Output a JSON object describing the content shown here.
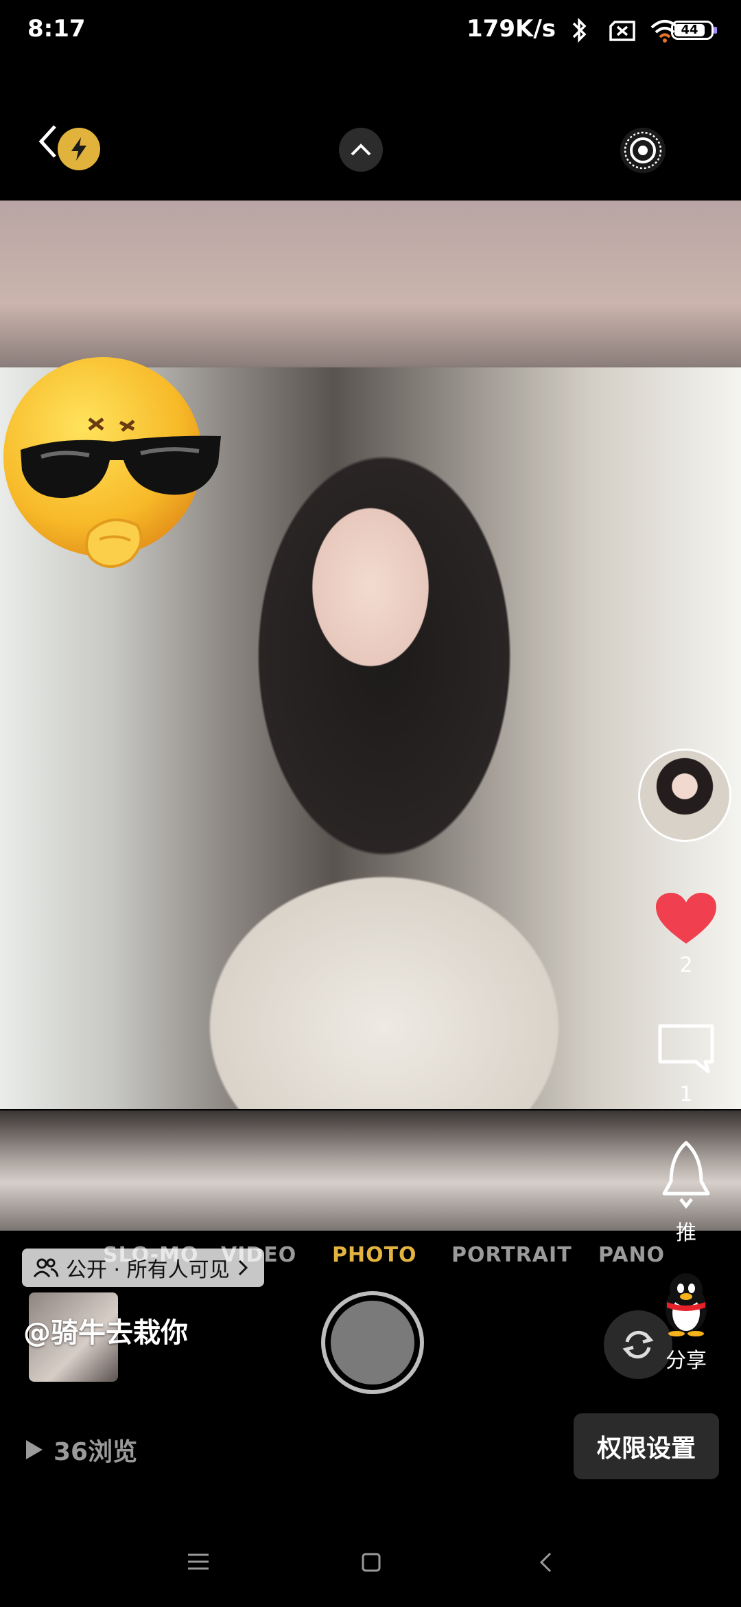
{
  "status_bar": {
    "time": "8:17",
    "net_speed": "179K/s",
    "battery_level": "44",
    "icons": [
      "bluetooth-icon",
      "sim-off-icon",
      "wifi-icon",
      "battery-icon"
    ]
  },
  "camera": {
    "modes": [
      "SLO-MO",
      "VIDEO",
      "PHOTO",
      "PORTRAIT",
      "PANO"
    ],
    "active_mode": "PHOTO"
  },
  "post": {
    "privacy_label": "公开 · 所有人可见",
    "username": "@骑牛去栽你",
    "views": "36浏览",
    "permission_button": "权限设置"
  },
  "rail": {
    "likes": "2",
    "comments": "1",
    "push_label": "推",
    "share_label": "分享"
  },
  "colors": {
    "active_mode": "#e3b341",
    "like": "#f0404f"
  }
}
